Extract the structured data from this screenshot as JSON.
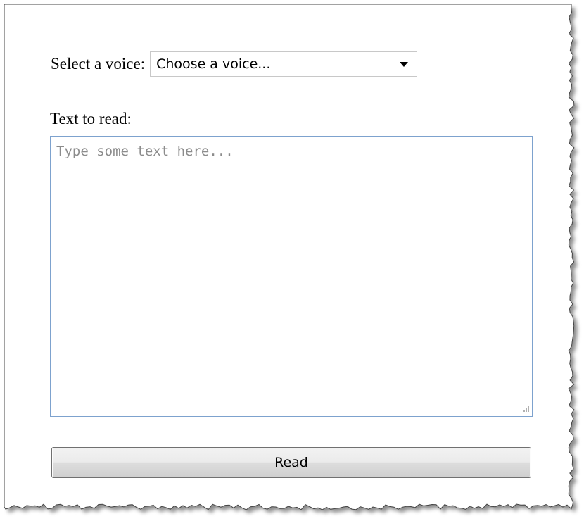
{
  "form": {
    "voice_label": "Select a voice:",
    "voice_select_value": "Choose a voice...",
    "text_label": "Text to read:",
    "text_placeholder": "Type some text here...",
    "read_button_label": "Read"
  },
  "icons": {
    "dropdown": "chevron-down-icon",
    "resize": "resize-grip-icon"
  },
  "colors": {
    "textarea_border": "#7da2ce",
    "placeholder_text": "#8c8c8c",
    "button_border": "#707070"
  }
}
